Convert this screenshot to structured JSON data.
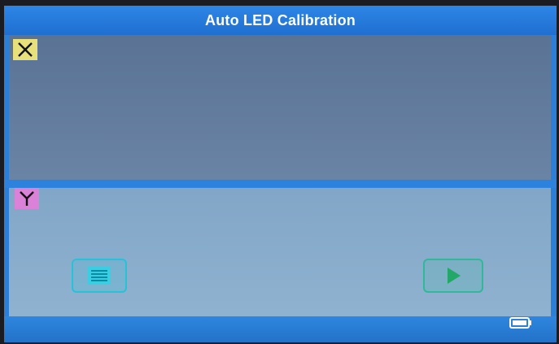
{
  "title": "Auto LED Calibration",
  "panels": {
    "x": {
      "label": "X"
    },
    "y": {
      "label": "Y"
    }
  },
  "buttons": {
    "menu": {
      "icon": "list-menu-icon"
    },
    "start": {
      "icon": "play-icon"
    }
  },
  "status": {
    "battery_icon": "battery-icon"
  },
  "colors": {
    "title_bar": "#2d86e6",
    "panel_x": "#5f7a9c",
    "panel_y": "#88abcb",
    "badge_x": "#e8e07a",
    "badge_y": "#d982d8",
    "menu_button": "#26c2d8",
    "start_button": "#2fb89a"
  }
}
